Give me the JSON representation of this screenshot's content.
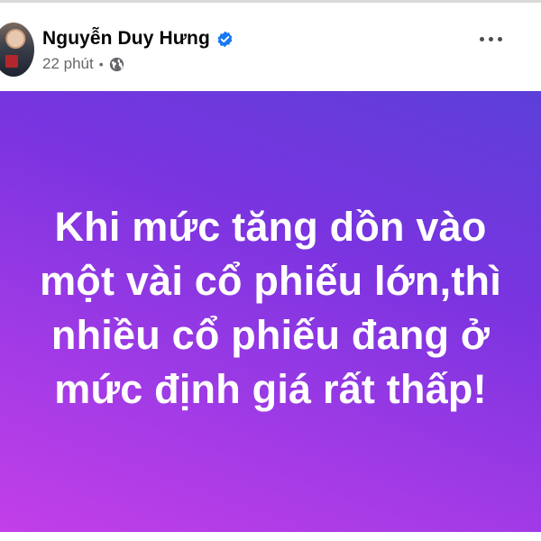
{
  "post": {
    "author_name": "Nguyễn Duy Hưng",
    "time": "22 phút",
    "separator": "•",
    "body_text": "Khi mức tăng dồn vào một vài cổ phiếu lớn,thì nhiều cổ phiếu đang ở mức định giá rất thấp!",
    "background_gradient": [
      "#5c3fd8",
      "#7a34e0",
      "#a33be6",
      "#c43fe8"
    ],
    "text_color": "#ffffff"
  },
  "icons": {
    "verified": "verified-badge-icon",
    "privacy": "globe-icon",
    "menu": "more-horizontal-icon"
  },
  "colors": {
    "verified_blue": "#1877f2",
    "meta_gray": "#65676b"
  }
}
